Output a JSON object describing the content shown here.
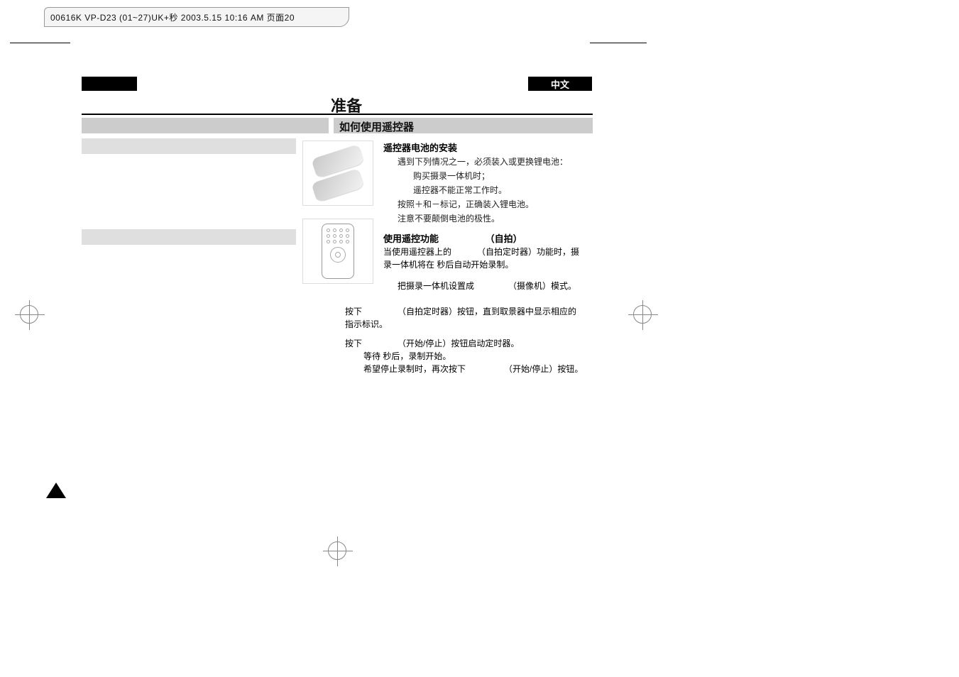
{
  "printHeader": "00616K VP-D23 (01~27)UK+秒 2003.5.15 10:16 AM 页面20",
  "langTag": "中文",
  "sectionTitle": "准备",
  "subsectionTitle": "如何使用遥控器",
  "battery": {
    "heading": "遥控器电池的安装",
    "line1": "遇到下列情况之一，必须装入或更换锂电池：",
    "bullet1": "购买摄录一体机时；",
    "bullet2": "遥控器不能正常工作时。",
    "line2": "按照＋和－标记，正确装入锂电池。",
    "line3": "注意不要颠倒电池的极性。"
  },
  "remote": {
    "headingMain": "使用遥控功能",
    "headingSelfie": "（自拍）",
    "l1a": "当使用遥控器上的",
    "l1b": "（自拍定时器）功能时，摄",
    "l2": "录一体机将在  秒后自动开始录制。",
    "l3a": "把摄录一体机设置成",
    "l3b": "（摄像机）模式。"
  },
  "step2": {
    "a": "按下",
    "b": "（自拍定时器）按钮，直到取景器中显示相应的",
    "c": "指示标识。"
  },
  "step3": {
    "a": "按下",
    "b": "（开始/停止）按钮启动定时器。",
    "c": "等待   秒后，录制开始。",
    "d1": "希望停止录制时，再次按下",
    "d2": "（开始/停止）按钮。"
  }
}
